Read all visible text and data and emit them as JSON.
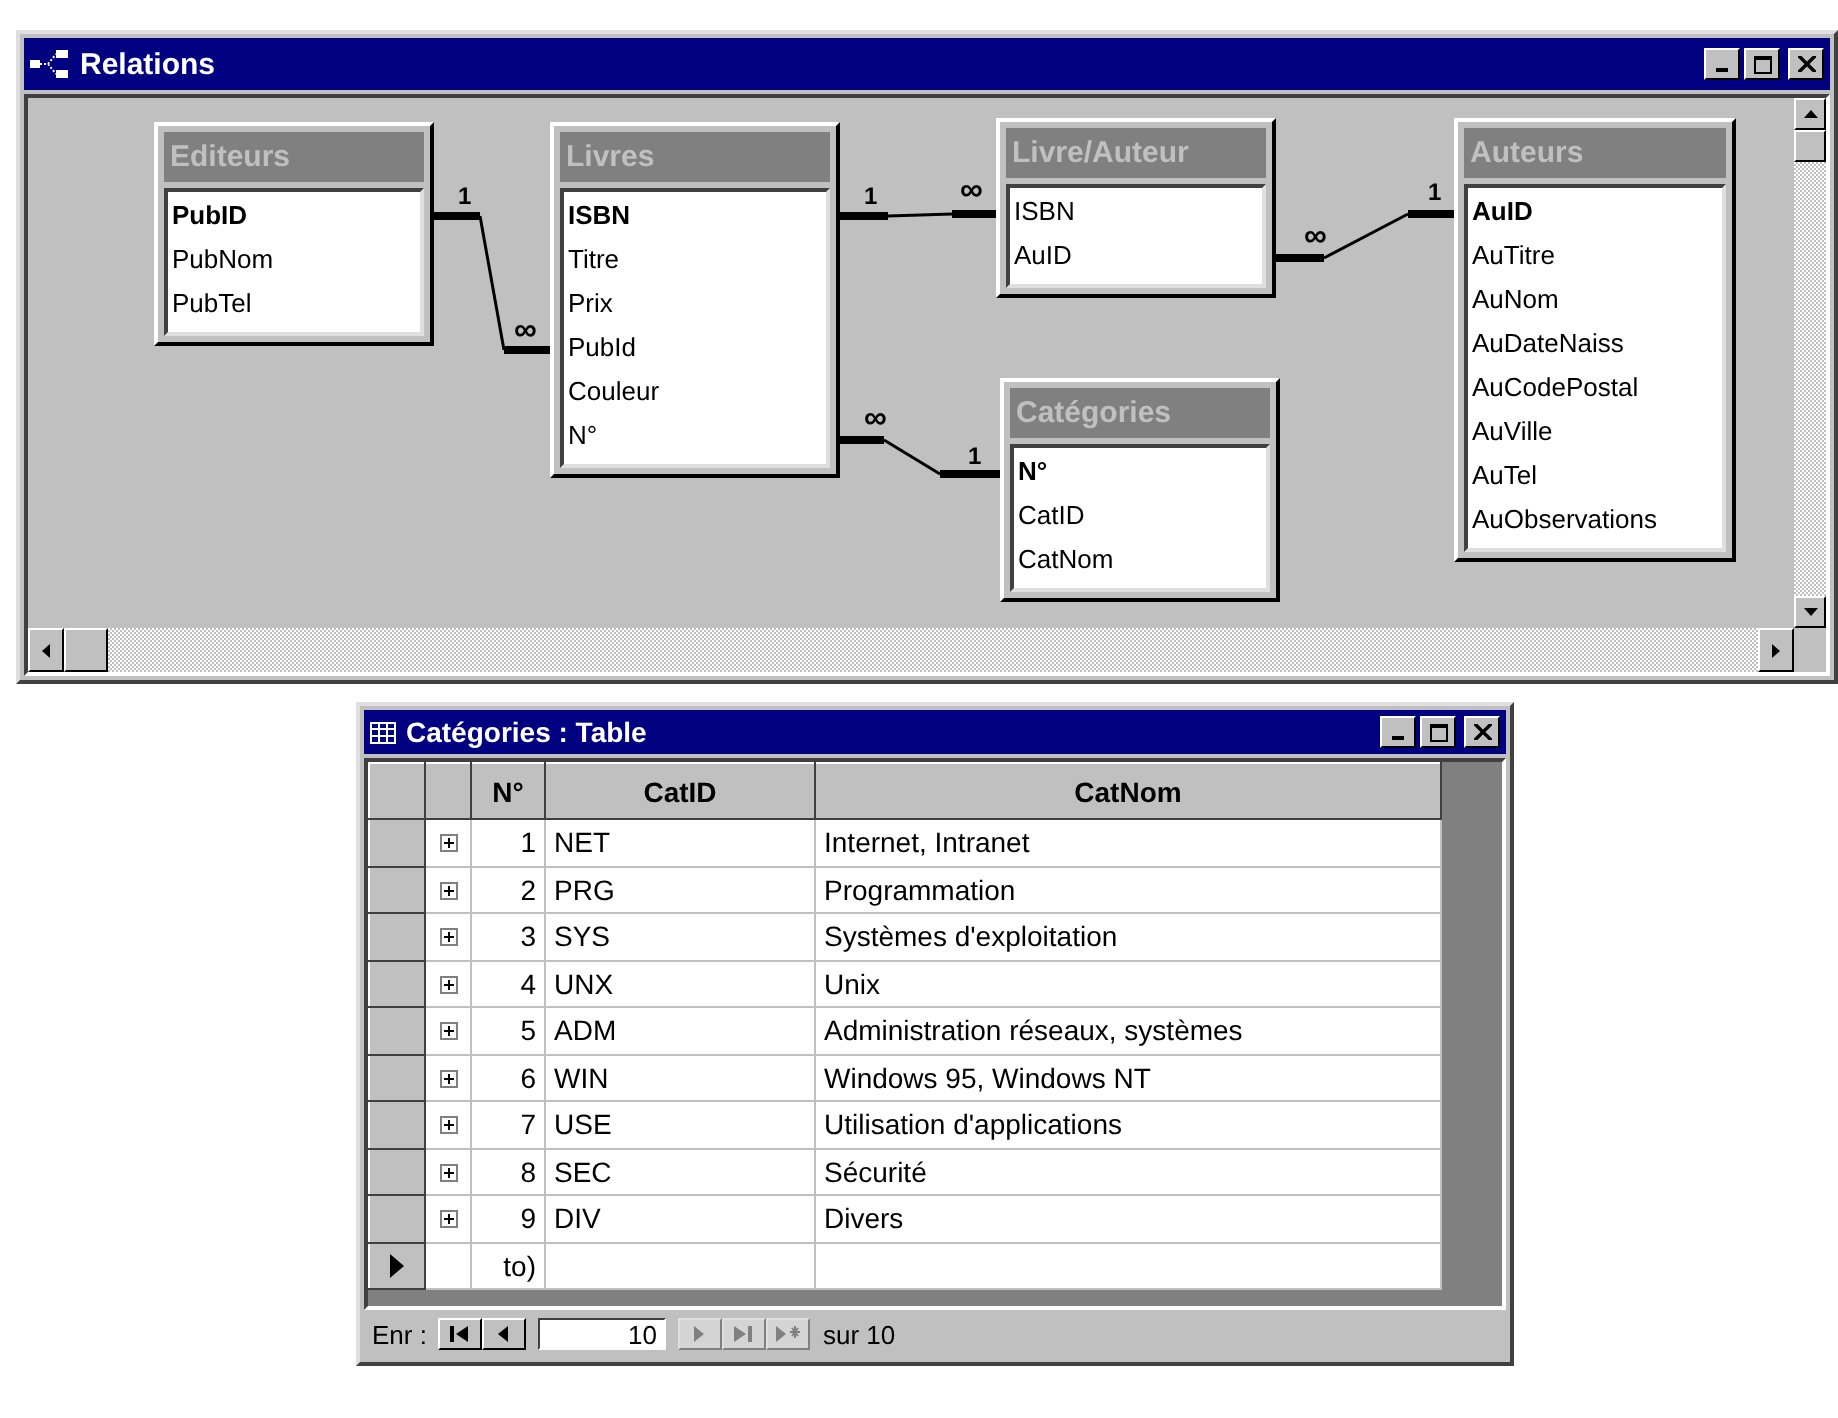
{
  "relations_window": {
    "title": "Relations",
    "tables": [
      {
        "name": "Editeurs",
        "fields": [
          {
            "name": "PubID",
            "primary_key": true
          },
          {
            "name": "PubNom",
            "primary_key": false
          },
          {
            "name": "PubTel",
            "primary_key": false
          }
        ]
      },
      {
        "name": "Livres",
        "fields": [
          {
            "name": "ISBN",
            "primary_key": true
          },
          {
            "name": "Titre",
            "primary_key": false
          },
          {
            "name": "Prix",
            "primary_key": false
          },
          {
            "name": "PubId",
            "primary_key": false
          },
          {
            "name": "Couleur",
            "primary_key": false
          },
          {
            "name": "N°",
            "primary_key": false
          }
        ]
      },
      {
        "name": "Livre/Auteur",
        "fields": [
          {
            "name": "ISBN",
            "primary_key": false
          },
          {
            "name": "AuID",
            "primary_key": false
          }
        ]
      },
      {
        "name": "Catégories",
        "fields": [
          {
            "name": "N°",
            "primary_key": true
          },
          {
            "name": "CatID",
            "primary_key": false
          },
          {
            "name": "CatNom",
            "primary_key": false
          }
        ]
      },
      {
        "name": "Auteurs",
        "fields": [
          {
            "name": "AuID",
            "primary_key": true
          },
          {
            "name": "AuTitre",
            "primary_key": false
          },
          {
            "name": "AuNom",
            "primary_key": false
          },
          {
            "name": "AuDateNaiss",
            "primary_key": false
          },
          {
            "name": "AuCodePostal",
            "primary_key": false
          },
          {
            "name": "AuVille",
            "primary_key": false
          },
          {
            "name": "AuTel",
            "primary_key": false
          },
          {
            "name": "AuObservations",
            "primary_key": false
          }
        ]
      }
    ],
    "relationships": [
      {
        "one_label": "1",
        "many_label": "∞"
      },
      {
        "one_label": "1",
        "many_label": "∞"
      },
      {
        "one_label": "1",
        "many_label": "∞"
      },
      {
        "one_label": "1",
        "many_label": "∞"
      }
    ]
  },
  "table_window": {
    "title": "Catégories : Table",
    "columns": [
      "N°",
      "CatID",
      "CatNom"
    ],
    "rows": [
      {
        "kind": "record",
        "n": "1",
        "cat_id": "NET",
        "cat_nom": "Internet, Intranet",
        "expanded": false,
        "selected": false
      },
      {
        "kind": "record",
        "n": "2",
        "cat_id": "PRG",
        "cat_nom": "Programmation",
        "expanded": false,
        "selected": false
      },
      {
        "kind": "record",
        "n": "3",
        "cat_id": "SYS",
        "cat_nom": "Systèmes d'exploitation",
        "expanded": false,
        "selected": false
      },
      {
        "kind": "record",
        "n": "4",
        "cat_id": "UNX",
        "cat_nom": "Unix",
        "expanded": false,
        "selected": false
      },
      {
        "kind": "record",
        "n": "5",
        "cat_id": "ADM",
        "cat_nom": "Administration réseaux, systèmes",
        "expanded": false,
        "selected": false
      },
      {
        "kind": "record",
        "n": "6",
        "cat_id": "WIN",
        "cat_nom": "Windows 95, Windows NT",
        "expanded": false,
        "selected": false
      },
      {
        "kind": "record",
        "n": "7",
        "cat_id": "USE",
        "cat_nom": "Utilisation d'applications",
        "expanded": false,
        "selected": false
      },
      {
        "kind": "record",
        "n": "8",
        "cat_id": "SEC",
        "cat_nom": "Sécurité",
        "expanded": false,
        "selected": false
      },
      {
        "kind": "record",
        "n": "9",
        "cat_id": "DIV",
        "cat_nom": "Divers",
        "expanded": false,
        "selected": false
      },
      {
        "kind": "new",
        "n": "to)",
        "selected": true
      }
    ],
    "navigation": {
      "label": "Enr :",
      "record": "10",
      "total": "sur 10",
      "buttons": [
        {
          "kind": "first",
          "disabled": false
        },
        {
          "kind": "prev",
          "disabled": false
        },
        {
          "kind": "next",
          "disabled": true
        },
        {
          "kind": "last",
          "disabled": true
        },
        {
          "kind": "new",
          "disabled": true
        }
      ]
    }
  }
}
